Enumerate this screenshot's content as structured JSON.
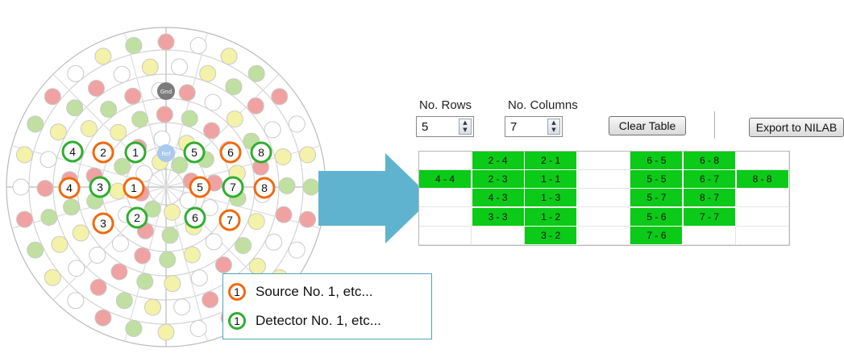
{
  "colors": {
    "source": "#ee6a10",
    "detector": "#2fae2f",
    "grid_on": "#0bca18",
    "arrow": "#5fb3cf",
    "head_red": "#f0a2a2",
    "head_green": "#bfe0a0",
    "head_yellow": "#f4f2a8",
    "head_white": "#ffffff",
    "gnd": "#7b7b7b",
    "ref": "#a9c9ef"
  },
  "head": {
    "gnd_label": "Gnd",
    "ref_label": "Ref"
  },
  "optodes": {
    "sources": [
      "4",
      "2",
      "4",
      "1",
      "5",
      "6",
      "8",
      "3",
      "7"
    ],
    "detectors": [
      "4",
      "1",
      "5",
      "8",
      "3",
      "7",
      "2",
      "6"
    ]
  },
  "panel": {
    "rows_label": "No. Rows",
    "rows_value": "5",
    "cols_label": "No. Columns",
    "cols_value": "7",
    "clear_button": "Clear Table",
    "export_button": "Export to NILAB"
  },
  "table": {
    "rows": [
      [
        "",
        "2 - 4",
        "2 - 1",
        "",
        "6 - 5",
        "6 - 8",
        ""
      ],
      [
        "4 - 4",
        "2 - 3",
        "1 - 1",
        "",
        "5 - 5",
        "6 - 7",
        "8 - 8"
      ],
      [
        "",
        "4 - 3",
        "1 - 3",
        "",
        "5 - 7",
        "8 - 7",
        ""
      ],
      [
        "",
        "3 - 3",
        "1 - 2",
        "",
        "5 - 6",
        "7 - 7",
        ""
      ],
      [
        "",
        "",
        "3 - 2",
        "",
        "7 - 6",
        "",
        ""
      ]
    ]
  },
  "legend": {
    "source_number": "1",
    "source_text": "Source No. 1, etc...",
    "detector_number": "1",
    "detector_text": "Detector No. 1, etc..."
  }
}
